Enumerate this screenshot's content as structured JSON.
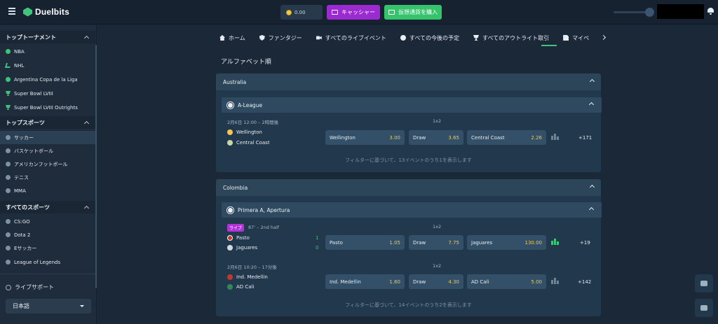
{
  "header": {
    "logo_text": "Duelbits",
    "balance": "0.00",
    "cashier_label": "キャッシャー",
    "buy_crypto_label": "仮想通貨を購入"
  },
  "sidebar": {
    "sections": [
      {
        "title": "トップトーナメント",
        "items": [
          {
            "label": "NBA",
            "icon": "basketball-icon"
          },
          {
            "label": "NHL",
            "icon": "hockey-stick-icon"
          },
          {
            "label": "Argentina Copa de la Liga",
            "icon": "soccer-ball-icon"
          },
          {
            "label": "Super Bowl LVIII",
            "icon": "trophy-icon"
          },
          {
            "label": "Super Bowl LVIII Outrights",
            "icon": "trophy-icon"
          }
        ]
      },
      {
        "title": "トップスポーツ",
        "items": [
          {
            "label": "サッカー",
            "icon": "soccer-ball-icon",
            "active": true
          },
          {
            "label": "バスケットボール",
            "icon": "basketball-icon"
          },
          {
            "label": "アメリカンフットボール",
            "icon": "american-football-icon"
          },
          {
            "label": "テニス",
            "icon": "tennis-ball-icon"
          },
          {
            "label": "MMA",
            "icon": "mma-icon"
          }
        ]
      },
      {
        "title": "すべてのスポーツ",
        "items": [
          {
            "label": "CS:GO",
            "icon": "csgo-icon"
          },
          {
            "label": "Dota 2",
            "icon": "dota-icon"
          },
          {
            "label": "Eサッカー",
            "icon": "esoccer-icon"
          },
          {
            "label": "League of Legends",
            "icon": "lol-icon"
          }
        ]
      }
    ],
    "live_support": "ライブサポート",
    "language": "日本語"
  },
  "nav": {
    "items": [
      {
        "label": "ホーム",
        "icon": "home-icon"
      },
      {
        "label": "ファンタジー",
        "icon": "shield-icon"
      },
      {
        "label": "すべてのライブイベント",
        "icon": "video-icon"
      },
      {
        "label": "すべての今後の予定",
        "icon": "timer-icon"
      },
      {
        "label": "すべてのアウトライト取引",
        "icon": "trophy-icon"
      },
      {
        "label": "マイベ",
        "icon": "betslip-icon"
      }
    ]
  },
  "main": {
    "sort_title": "アルファベット順",
    "countries": [
      {
        "name": "Australia",
        "league": "A-League",
        "events": [
          {
            "time": "2月6日 12:00 – 2時間後",
            "live": false,
            "home": "Wellington",
            "away": "Central Coast",
            "market": "1x2",
            "odds": [
              {
                "label": "Wellington",
                "value": "3.00"
              },
              {
                "label": "Draw",
                "value": "3.65"
              },
              {
                "label": "Central Coast",
                "value": "2.26"
              }
            ],
            "more": "+171"
          }
        ],
        "filter_note": "フィルターに基づいて、13イベントのうち1を表示します"
      },
      {
        "name": "Colombia",
        "league": "Primera A, Apertura",
        "events": [
          {
            "live_label": "ライブ",
            "time": "87' – 2nd half",
            "live": true,
            "home": "Pasto",
            "away": "Jaguares",
            "home_score": "1",
            "away_score": "0",
            "market": "1x2",
            "odds": [
              {
                "label": "Pasto",
                "value": "1.05"
              },
              {
                "label": "Draw",
                "value": "7.75"
              },
              {
                "label": "Jaguares",
                "value": "130.00"
              }
            ],
            "more": "+19"
          },
          {
            "time": "2月6日 10:20 – 17分後",
            "live": false,
            "home": "Ind. Medellin",
            "away": "AD Cali",
            "market": "1x2",
            "odds": [
              {
                "label": "Ind. Medellin",
                "value": "1.60"
              },
              {
                "label": "Draw",
                "value": "4.30"
              },
              {
                "label": "AD Cali",
                "value": "5.00"
              }
            ],
            "more": "+142"
          }
        ],
        "filter_note": "フィルターに基づいて、14イベントのうち2を表示します"
      }
    ]
  },
  "colors": {
    "accent_green": "#3fc47b",
    "cashier_purple": "#9b2bd1",
    "odds_yellow": "#f0c94a",
    "live_magenta": "#b233d8"
  }
}
